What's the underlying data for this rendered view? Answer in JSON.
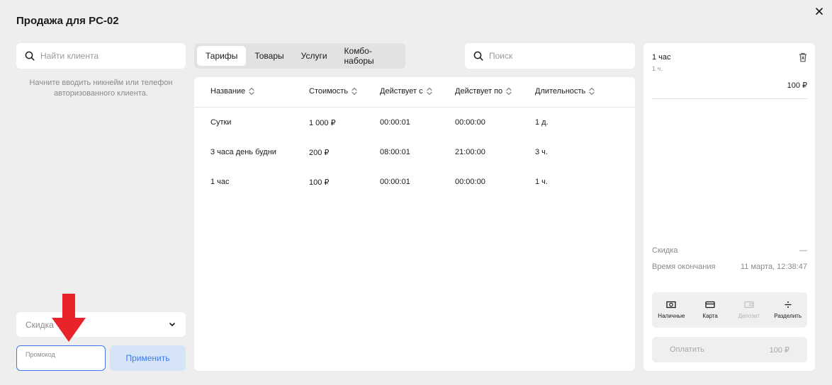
{
  "title": "Продажа для PC-02",
  "client": {
    "search_placeholder": "Найти клиента",
    "hint_line1": "Начните вводить никнейм или телефон",
    "hint_line2": "авторизованного клиента."
  },
  "discount": {
    "label": "Скидка"
  },
  "promo": {
    "label": "Промокод",
    "value": "",
    "apply_label": "Применить"
  },
  "tabs": [
    {
      "label": "Тарифы",
      "active": true
    },
    {
      "label": "Товары",
      "active": false
    },
    {
      "label": "Услуги",
      "active": false
    },
    {
      "label": "Комбо-наборы",
      "active": false
    }
  ],
  "search": {
    "placeholder": "Поиск"
  },
  "table": {
    "columns": [
      "Название",
      "Стоимость",
      "Действует с",
      "Действует по",
      "Длительность"
    ],
    "rows": [
      [
        "Сутки",
        "1 000 ₽",
        "00:00:01",
        "00:00:00",
        "1 д."
      ],
      [
        "3 часа день будни",
        "200 ₽",
        "08:00:01",
        "21:00:00",
        "3 ч."
      ],
      [
        "1 час",
        "100 ₽",
        "00:00:01",
        "00:00:00",
        "1 ч."
      ]
    ]
  },
  "cart": {
    "item": {
      "name": "1 час",
      "sub": "1 ч.",
      "price": "100 ₽"
    },
    "discount_label": "Скидка",
    "discount_value": "—",
    "end_time_label": "Время окончания",
    "end_time_value": "11 марта, 12:38:47",
    "payment_methods": [
      {
        "label": "Наличные",
        "icon": "cash-icon",
        "enabled": true
      },
      {
        "label": "Карта",
        "icon": "card-icon",
        "enabled": true
      },
      {
        "label": "Депозит",
        "icon": "wallet-icon",
        "enabled": false
      },
      {
        "label": "Разделить",
        "icon": "divide-icon",
        "enabled": true
      }
    ],
    "pay_label": "Оплатить",
    "pay_amount": "100 ₽"
  },
  "colors": {
    "accent": "#3d7bea",
    "annotation_arrow": "#e8232a"
  }
}
